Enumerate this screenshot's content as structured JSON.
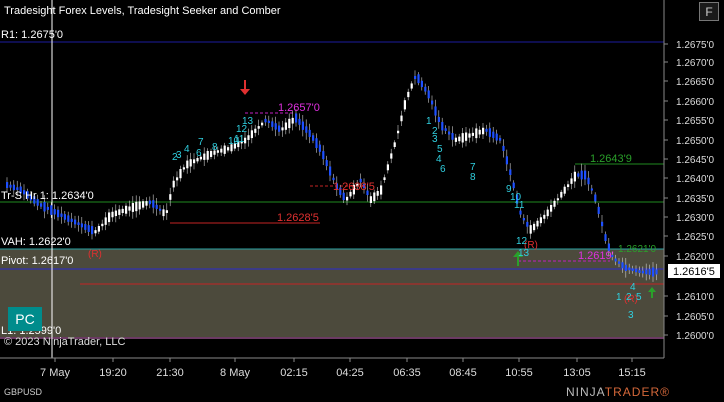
{
  "title": "Tradesight Forex Levels, Tradesight Seeker and Comber",
  "window_button": "F",
  "levels": {
    "r1": "R1: 1.2675'0",
    "tr_s": "Tr-S Hr 1: 1.2634'0",
    "vah": "VAH: 1.2622'0",
    "pivot": "Pivot: 1.2617'0",
    "l1": "L1: 1.2599'0"
  },
  "price_axis": [
    "1.2675'0",
    "1.2670'0",
    "1.2665'0",
    "1.2660'0",
    "1.2655'0",
    "1.2650'0",
    "1.2645'0",
    "1.2640'0",
    "1.2635'0",
    "1.2630'0",
    "1.2625'0",
    "1.2620'0",
    "1.2610'0",
    "1.2605'0",
    "1.2600'0"
  ],
  "current_price": "1.2616'5",
  "time_axis": [
    "7 May",
    "19:20",
    "21:30",
    "8 May",
    "02:15",
    "04:25",
    "06:35",
    "08:45",
    "10:55",
    "13:05",
    "15:15"
  ],
  "annotations": {
    "magenta_high": "1.2657'0",
    "magenta_low": "1.2619'",
    "red_mid": "1.2638'5",
    "red_low": "1.2628'5",
    "green_right": "1.2643'9",
    "green_right2": "1.2621'0",
    "r_left": "(R)",
    "r_mid": "(R)",
    "r_right": "(R)"
  },
  "pc_button": "PC",
  "copyright": "© 2023 NinjaTrader, LLC",
  "symbol": "GBPUSD",
  "brand_left": "NINJA",
  "brand_right": "TRADER®",
  "colors": {
    "up": "#ffffff",
    "down": "#1e50ff",
    "r1": "#1c1c9e",
    "pivot": "#2a2acf",
    "vah": "#2aa3a3",
    "trs": "#1f8a1f",
    "l1": "#8a2a8a",
    "band": "#4c4a3c"
  }
}
